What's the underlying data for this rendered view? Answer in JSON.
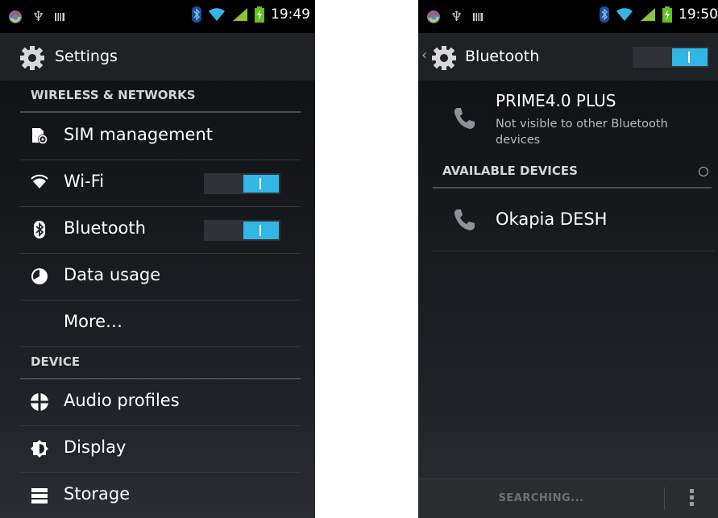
{
  "left": {
    "status": {
      "time": "19:49"
    },
    "title": "Settings",
    "sections": [
      {
        "header": "WIRELESS & NETWORKS",
        "items": [
          {
            "label": "SIM management",
            "icon": "sim-card-icon"
          },
          {
            "label": "Wi-Fi",
            "icon": "wifi-icon",
            "toggle": "on"
          },
          {
            "label": "Bluetooth",
            "icon": "bluetooth-icon",
            "toggle": "on"
          },
          {
            "label": "Data usage",
            "icon": "data-usage-icon"
          },
          {
            "label": "More…"
          }
        ]
      },
      {
        "header": "DEVICE",
        "items": [
          {
            "label": "Audio profiles",
            "icon": "audio-profiles-icon"
          },
          {
            "label": "Display",
            "icon": "display-icon"
          },
          {
            "label": "Storage",
            "icon": "storage-icon"
          }
        ]
      }
    ]
  },
  "right": {
    "status": {
      "time": "19:50"
    },
    "title": "Bluetooth",
    "toggle": "on",
    "this_device": {
      "name": "PRIME4.0 PLUS",
      "status": "Not visible to other Bluetooth devices"
    },
    "available_header": "AVAILABLE DEVICES",
    "devices": [
      {
        "name": "Okapia DESH",
        "icon": "phone-icon"
      }
    ],
    "bottom": {
      "searching": "SEARCHING..."
    }
  },
  "colors": {
    "accent": "#33b5e5",
    "battery": "#60c21d",
    "signal": "#8ac33a"
  }
}
